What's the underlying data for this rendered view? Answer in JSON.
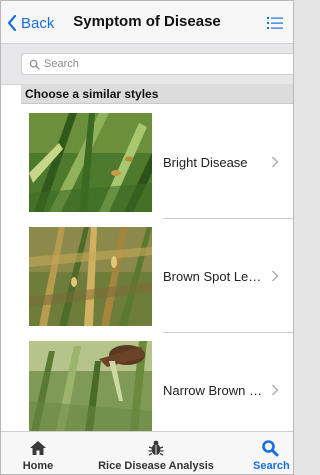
{
  "nav": {
    "back_label": "Back",
    "title": "Symptom of Disease"
  },
  "search": {
    "placeholder": "Search",
    "value": ""
  },
  "section": {
    "header": "Choose a similar styles"
  },
  "list": {
    "items": [
      {
        "label": "Bright Disease"
      },
      {
        "label": "Brown Spot Le…"
      },
      {
        "label": "Narrow Brown …"
      }
    ]
  },
  "tabs": [
    {
      "label": "Home",
      "icon": "home-icon"
    },
    {
      "label": "Rice Disease Analysis",
      "icon": "bug-icon"
    },
    {
      "label": "Search",
      "icon": "search-icon",
      "active": true
    }
  ],
  "colors": {
    "accent": "#1a6fe0",
    "nav_bg": "#f7f7f8",
    "section_bg": "#dcdcdc"
  }
}
